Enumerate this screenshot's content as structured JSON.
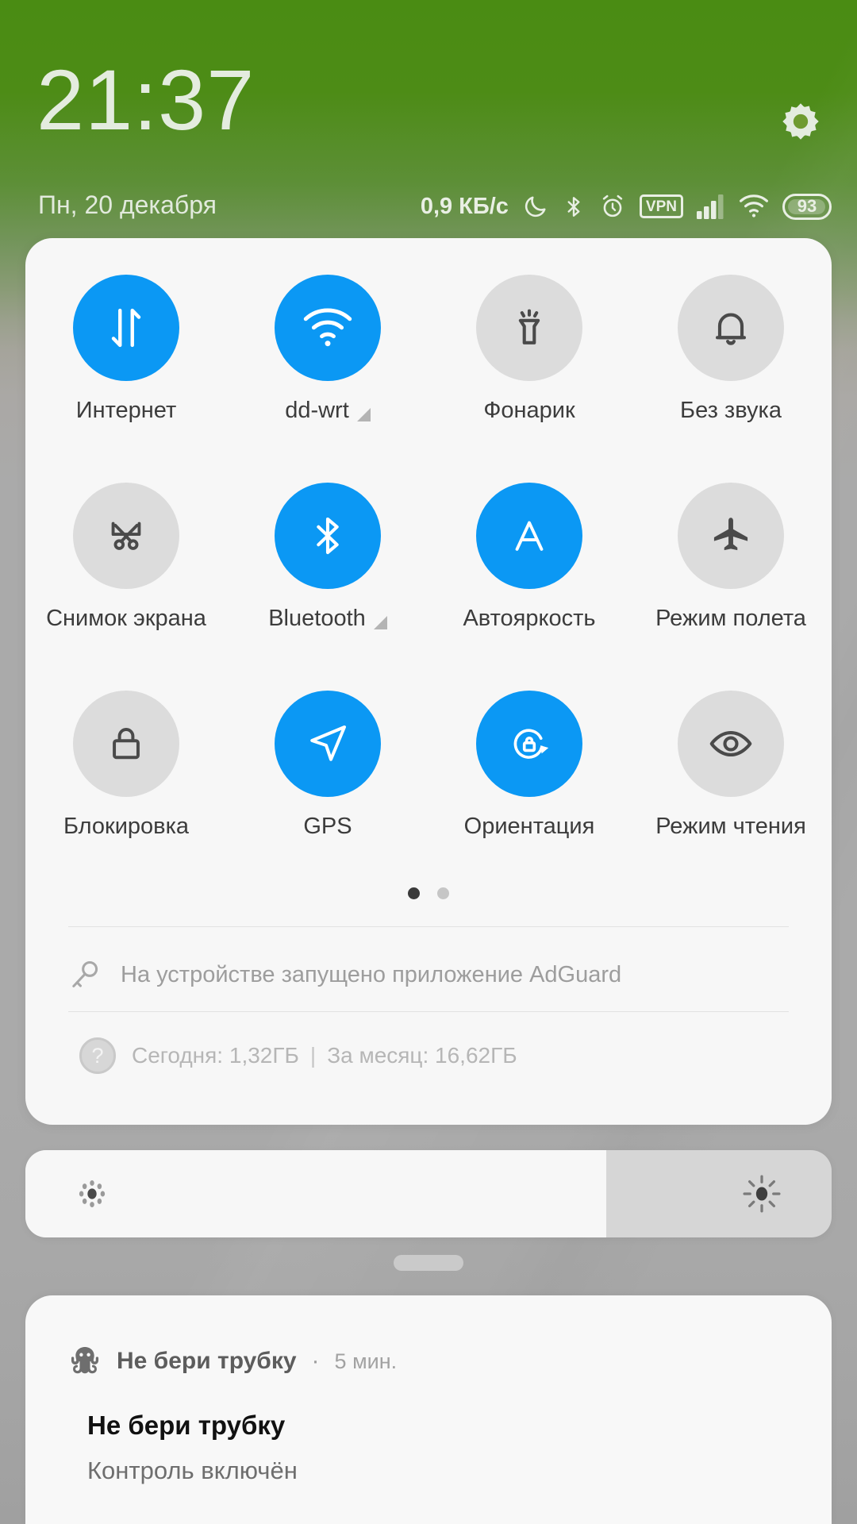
{
  "statusbar": {
    "clock": "21:37",
    "date": "Пн, 20 декабря",
    "net_speed": "0,9 КБ/с",
    "vpn_label": "VPN",
    "battery_level": "93",
    "icons": [
      "dnd-moon-icon",
      "bluetooth-icon",
      "alarm-icon",
      "vpn-icon",
      "signal-icon",
      "wifi-icon",
      "battery-icon"
    ],
    "settings_icon": "gear-icon"
  },
  "quick_settings": {
    "tiles": [
      {
        "label": "Интернет",
        "icon": "data-transfer-icon",
        "active": true,
        "expandable": false
      },
      {
        "label": "dd-wrt",
        "icon": "wifi-icon",
        "active": true,
        "expandable": true
      },
      {
        "label": "Фонарик",
        "icon": "flashlight-icon",
        "active": false,
        "expandable": false
      },
      {
        "label": "Без звука",
        "icon": "bell-icon",
        "active": false,
        "expandable": false
      },
      {
        "label": "Снимок экрана",
        "icon": "screenshot-icon",
        "active": false,
        "expandable": false
      },
      {
        "label": "Bluetooth",
        "icon": "bluetooth-icon",
        "active": true,
        "expandable": true
      },
      {
        "label": "Автояркость",
        "icon": "auto-brightness-icon",
        "active": true,
        "expandable": false
      },
      {
        "label": "Режим полета",
        "icon": "airplane-icon",
        "active": false,
        "expandable": false
      },
      {
        "label": "Блокировка",
        "icon": "lock-icon",
        "active": false,
        "expandable": false
      },
      {
        "label": "GPS",
        "icon": "navigation-icon",
        "active": true,
        "expandable": false
      },
      {
        "label": "Ориентация",
        "icon": "rotation-lock-icon",
        "active": true,
        "expandable": false
      },
      {
        "label": "Режим чтения",
        "icon": "eye-icon",
        "active": false,
        "expandable": false
      }
    ],
    "pages": {
      "count": 2,
      "current": 1
    },
    "vpn_notice": {
      "icon": "key-icon",
      "text": "На устройстве запущено приложение AdGuard"
    },
    "data_usage": {
      "icon": "question-icon",
      "today_label": "Сегодня: 1,32ГБ",
      "separator": "|",
      "month_label": "За месяц: 16,62ГБ"
    }
  },
  "brightness": {
    "value_percent": 72,
    "low_icon": "brightness-low-icon",
    "high_icon": "brightness-high-icon"
  },
  "notification": {
    "app_name": "Не бери трубку",
    "bullet": "·",
    "time": "5 мин.",
    "title": "Не бери трубку",
    "body": "Контроль включён",
    "icon": "octopus-icon"
  },
  "colors": {
    "accent_active": "#0b98f4",
    "tile_inactive": "#dcdcdc",
    "panel_bg": "#f7f7f7",
    "wallpaper_top": "#4a8c13",
    "wallpaper_bottom": "#aaaaaa"
  }
}
